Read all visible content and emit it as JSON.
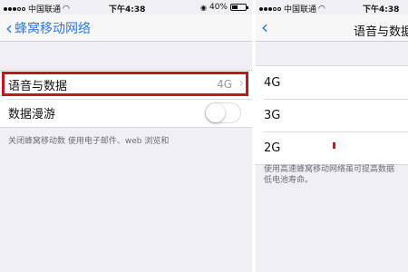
{
  "left": {
    "status": {
      "carrier": "中国联通",
      "time": "下午4:38",
      "battery": "40%",
      "battery_level": 0.4
    },
    "nav": {
      "back_label": "蜂窝移动网络"
    },
    "rows": [
      {
        "label": "语音与数据",
        "value": "4G"
      },
      {
        "label": "数据漫游",
        "toggle_on": false
      }
    ],
    "footnote": "关闭蜂窝移动数    使用电子邮件、web 浏览和"
  },
  "right": {
    "status": {
      "carrier": "中国联通",
      "time": "下午4:38"
    },
    "nav": {
      "title": "语音与数据"
    },
    "options": [
      "4G",
      "3G",
      "2G"
    ],
    "footnote": "使用高速蜂窝移动网络虽可提高数据 低电池寿命。"
  },
  "colors": {
    "accent": "#2a7ae2",
    "highlight_border": "#c01820",
    "mark": "#d8101a"
  },
  "icons": [
    "signal-dots-icon",
    "wifi-icon",
    "lock-icon",
    "battery-icon",
    "chevron-left-icon",
    "chevron-right-icon"
  ]
}
